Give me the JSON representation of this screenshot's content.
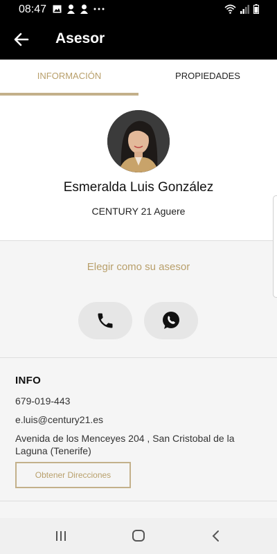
{
  "status_bar": {
    "time": "08:47",
    "left_icons": [
      "image-icon",
      "user-icon",
      "user-icon",
      "more-icon"
    ],
    "right_icons": [
      "wifi-icon",
      "signal-icon",
      "battery-icon"
    ]
  },
  "app_bar": {
    "title": "Asesor",
    "back_icon": "arrow-left-icon"
  },
  "tabs": [
    {
      "label": "INFORMACIÓN",
      "active": true
    },
    {
      "label": "PROPIEDADES",
      "active": false
    }
  ],
  "profile": {
    "name": "Esmeralda Luis González",
    "office": "CENTURY 21 Aguere"
  },
  "actions": {
    "choose_label": "Elegir como su asesor",
    "call_icon": "phone-icon",
    "whatsapp_icon": "whatsapp-icon"
  },
  "info": {
    "heading": "INFO",
    "phone": "679-019-443",
    "email": "e.luis@century21.es",
    "address": "Avenida de los Menceyes 204 , San Cristobal de la Laguna (Tenerife)",
    "directions_label": "Obtener Direcciones"
  },
  "colors": {
    "accent": "#b89f6a",
    "bar_background": "#000000",
    "page_background": "#f5f5f5"
  }
}
